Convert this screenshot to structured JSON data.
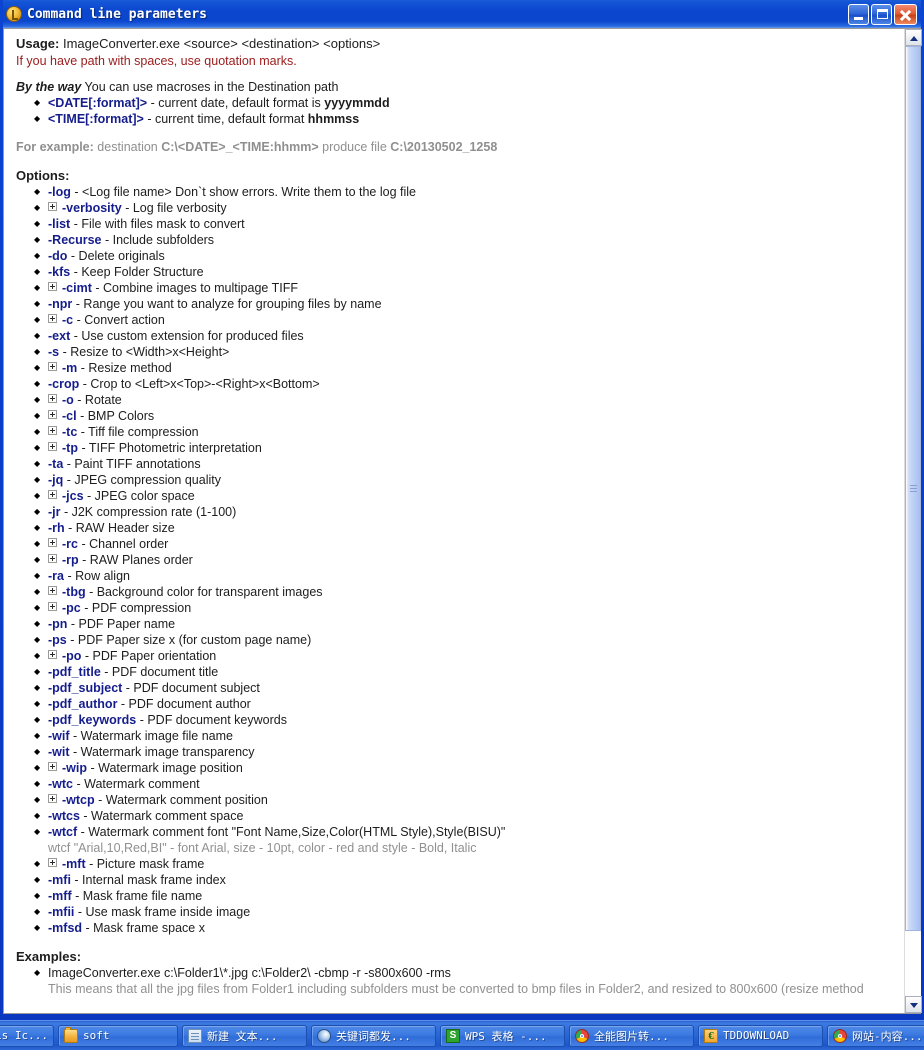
{
  "window": {
    "title": "Command line parameters",
    "icon": "app-coin-icon",
    "buttons": {
      "minimize": "Minimize",
      "maximize": "Maximize",
      "close": "Close"
    },
    "accent_titlebar": "#0b46cf",
    "accent_link": "#151d8c"
  },
  "content": {
    "usage_label": "Usage:",
    "usage_text": " ImageConverter.exe <source> <destination> <options>",
    "red_note": "If you have path with spaces, use quotation marks.",
    "btw_label": "By the way",
    "btw_text": " You can use macroses in the Destination path",
    "macros": [
      {
        "opt": "<DATE[:format]>",
        "desc": " - current date, default format is ",
        "bold_tail": "yyyymmdd"
      },
      {
        "opt": "<TIME[:format]>",
        "desc": " - current time, default format ",
        "bold_tail": "hhmmss"
      }
    ],
    "example_label": "For example:",
    "example_text_a": " destination ",
    "example_text_b": "C:\\<DATE>_<TIME:hhmm>",
    "example_text_c": " produce file ",
    "example_text_d": "C:\\20130502_1258",
    "options_heading": "Options:",
    "options": [
      {
        "expander": false,
        "opt": "-log",
        "desc": " - <Log file name> Don`t show errors. Write them to the log file"
      },
      {
        "expander": true,
        "opt": "-verbosity",
        "desc": " - Log file verbosity"
      },
      {
        "expander": false,
        "opt": "-list",
        "desc": " - File with files mask to convert"
      },
      {
        "expander": false,
        "opt": "-Recurse",
        "desc": " - Include subfolders"
      },
      {
        "expander": false,
        "opt": "-do",
        "desc": " - Delete originals"
      },
      {
        "expander": false,
        "opt": "-kfs",
        "desc": " - Keep Folder Structure"
      },
      {
        "expander": true,
        "opt": "-cimt",
        "desc": " - Combine images to multipage TIFF"
      },
      {
        "expander": false,
        "opt": "-npr",
        "desc": " - Range you want to analyze for grouping files by name"
      },
      {
        "expander": true,
        "opt": "-c",
        "desc": " - Convert action"
      },
      {
        "expander": false,
        "opt": "-ext",
        "desc": " - Use custom extension for produced files"
      },
      {
        "expander": false,
        "opt": "-s",
        "desc": " - Resize to <Width>x<Height>"
      },
      {
        "expander": true,
        "opt": "-m",
        "desc": " - Resize method"
      },
      {
        "expander": false,
        "opt": "-crop",
        "desc": " - Crop to <Left>x<Top>-<Right>x<Bottom>"
      },
      {
        "expander": true,
        "opt": "-o",
        "desc": " - Rotate"
      },
      {
        "expander": true,
        "opt": "-cl",
        "desc": " - BMP Colors"
      },
      {
        "expander": true,
        "opt": "-tc",
        "desc": " - Tiff file compression"
      },
      {
        "expander": true,
        "opt": "-tp",
        "desc": " - TIFF Photometric interpretation"
      },
      {
        "expander": false,
        "opt": "-ta",
        "desc": " - Paint TIFF annotations"
      },
      {
        "expander": false,
        "opt": "-jq",
        "desc": " - JPEG compression quality"
      },
      {
        "expander": true,
        "opt": "-jcs",
        "desc": " - JPEG color space"
      },
      {
        "expander": false,
        "opt": "-jr",
        "desc": " - J2K compression rate (1-100)"
      },
      {
        "expander": false,
        "opt": "-rh",
        "desc": " - RAW Header size"
      },
      {
        "expander": true,
        "opt": "-rc",
        "desc": " - Channel order"
      },
      {
        "expander": true,
        "opt": "-rp",
        "desc": " - RAW Planes order"
      },
      {
        "expander": false,
        "opt": "-ra",
        "desc": " - Row align"
      },
      {
        "expander": true,
        "opt": "-tbg",
        "desc": " - Background color for transparent images"
      },
      {
        "expander": true,
        "opt": "-pc",
        "desc": " - PDF compression"
      },
      {
        "expander": false,
        "opt": "-pn",
        "desc": " - PDF Paper name"
      },
      {
        "expander": false,
        "opt": "-ps",
        "desc": " - PDF Paper size x (for custom page name)"
      },
      {
        "expander": true,
        "opt": "-po",
        "desc": " - PDF Paper orientation"
      },
      {
        "expander": false,
        "opt": "-pdf_title",
        "desc": " - PDF document title"
      },
      {
        "expander": false,
        "opt": "-pdf_subject",
        "desc": " - PDF document subject"
      },
      {
        "expander": false,
        "opt": "-pdf_author",
        "desc": " - PDF document author"
      },
      {
        "expander": false,
        "opt": "-pdf_keywords",
        "desc": " - PDF document keywords"
      },
      {
        "expander": false,
        "opt": "-wif",
        "desc": " - Watermark image file name"
      },
      {
        "expander": false,
        "opt": "-wit",
        "desc": " - Watermark image transparency"
      },
      {
        "expander": true,
        "opt": "-wip",
        "desc": " - Watermark image position"
      },
      {
        "expander": false,
        "opt": "-wtc",
        "desc": " - Watermark comment"
      },
      {
        "expander": true,
        "opt": "-wtcp",
        "desc": " - Watermark comment position"
      },
      {
        "expander": false,
        "opt": "-wtcs",
        "desc": " - Watermark comment space"
      },
      {
        "expander": false,
        "opt": "-wtcf",
        "desc": " - Watermark comment font \"Font Name,Size,Color(HTML Style),Style(BISU)\""
      }
    ],
    "wtcf_note": "wtcf \"Arial,10,Red,BI\" - font Arial, size - 10pt, color - red and style - Bold, Italic",
    "options_tail": [
      {
        "expander": true,
        "opt": "-mft",
        "desc": " - Picture mask frame"
      },
      {
        "expander": false,
        "opt": "-mfi",
        "desc": " - Internal mask frame index"
      },
      {
        "expander": false,
        "opt": "-mff",
        "desc": " - Mask frame file name"
      },
      {
        "expander": false,
        "opt": "-mfii",
        "desc": " - Use mask frame inside image"
      },
      {
        "expander": false,
        "opt": "-mfsd",
        "desc": " - Mask frame space x"
      }
    ],
    "examples_heading": "Examples:",
    "examples": [
      {
        "command": "ImageConverter.exe c:\\Folder1\\*.jpg c:\\Folder2\\ -cbmp -r -s800x600 -rms",
        "note": "This means that all the jpg files from Folder1 including subfolders must be converted to bmp files in Folder2, and resized to 800x600 (resize method"
      }
    ]
  },
  "scrollbar": {
    "up_arrow": "scroll-up-icon",
    "down_arrow": "scroll-down-icon"
  },
  "taskbar": {
    "items": [
      {
        "label": "is Ic...",
        "icon": "none"
      },
      {
        "label": "soft",
        "icon": "folder-icon"
      },
      {
        "label": "新建 文本...",
        "icon": "notepad-icon"
      },
      {
        "label": "关键词都发...",
        "icon": "moon-icon"
      },
      {
        "label": "WPS 表格 -...",
        "icon": "wps-icon",
        "icon_text": "S"
      },
      {
        "label": "全能图片转...",
        "icon": "chrome-icon"
      },
      {
        "label": "TDDOWNLOAD",
        "icon": "td-icon",
        "icon_text": "€"
      },
      {
        "label": "网站-内容...",
        "icon": "chrome-icon"
      }
    ]
  }
}
